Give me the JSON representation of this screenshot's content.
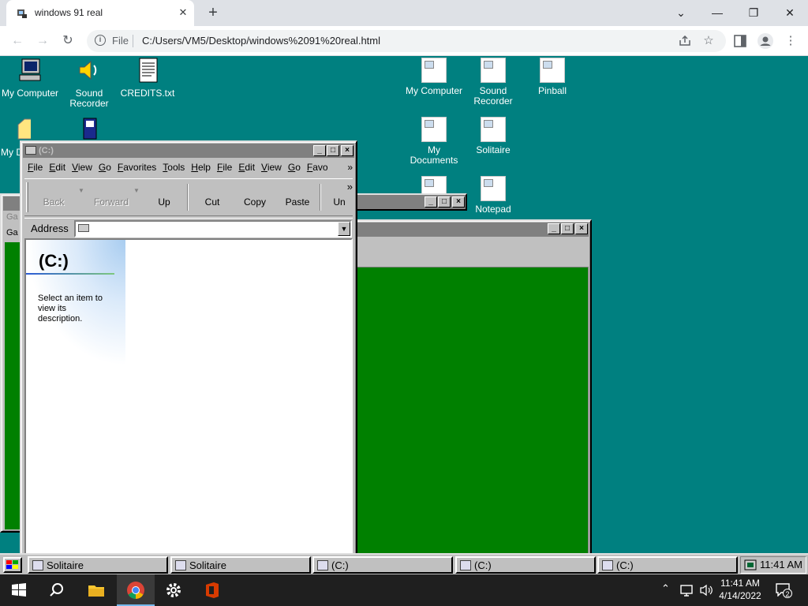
{
  "browser": {
    "tab_title": "windows 91 real",
    "tab_close": "✕",
    "new_tab": "+",
    "scheme_label": "File",
    "url": "C:/Users/VM5/Desktop/windows%2091%20real.html",
    "window_controls": [
      "⌄",
      "—",
      "❐",
      "✕"
    ]
  },
  "desktop_icons_left": [
    {
      "label": "My Computer",
      "icon": "computer-icon"
    },
    {
      "label": "Sound Recorder",
      "icon": "speaker-icon"
    },
    {
      "label": "CREDITS.txt",
      "icon": "document-icon"
    },
    {
      "label": "My D",
      "icon": "folder-icon"
    }
  ],
  "desktop_icons_right": [
    {
      "label": "My Computer"
    },
    {
      "label": "Sound Recorder"
    },
    {
      "label": "Pinball"
    },
    {
      "label": "My Documents"
    },
    {
      "label": "Solitaire"
    },
    {
      "label": "Notepad"
    }
  ],
  "explorer": {
    "title": "(C:)",
    "menu": [
      "File",
      "Edit",
      "View",
      "Go",
      "Favorites",
      "Tools",
      "Help",
      "File",
      "Edit",
      "View",
      "Go",
      "Favo"
    ],
    "menu_overflow": "»",
    "toolbar": [
      {
        "label": "Back",
        "enabled": false
      },
      {
        "label": "Forward",
        "enabled": false
      },
      {
        "label": "Up",
        "enabled": true
      },
      {
        "label": "Cut",
        "enabled": true
      },
      {
        "label": "Copy",
        "enabled": true
      },
      {
        "label": "Paste",
        "enabled": true
      },
      {
        "label": "Un",
        "enabled": true
      }
    ],
    "toolbar_overflow": "»",
    "address_label": "Address",
    "address_value": "",
    "content_title": "(C:)",
    "content_description": "Select an item to view its description."
  },
  "bg_window_left": {
    "menu_fragments": [
      "Ga",
      "Ga"
    ]
  },
  "w98_taskbar": {
    "tasks": [
      {
        "label": "Solitaire",
        "icon": "solitaire-icon"
      },
      {
        "label": "Solitaire",
        "icon": "solitaire-icon"
      },
      {
        "label": "(C:)",
        "icon": "drive-icon"
      },
      {
        "label": "(C:)",
        "icon": "drive-icon"
      },
      {
        "label": "(C:)",
        "icon": "drive-icon"
      }
    ],
    "clock": "11:41 AM"
  },
  "win10_taskbar": {
    "time": "11:41 AM",
    "date": "4/14/2022",
    "notification_count": "2"
  },
  "colors": {
    "desktop": "#008080",
    "solitaire_felt": "#008000",
    "w98_face": "#c0c0c0",
    "inactive_title": "#808080"
  }
}
